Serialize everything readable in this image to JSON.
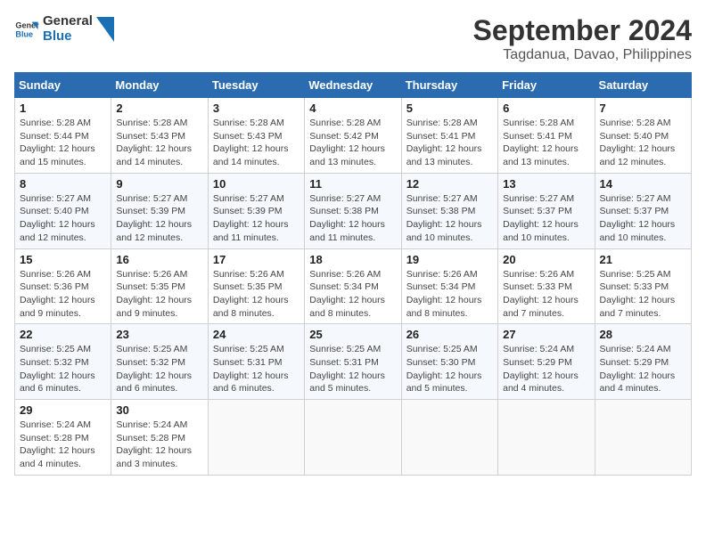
{
  "logo": {
    "text_general": "General",
    "text_blue": "Blue"
  },
  "title": "September 2024",
  "subtitle": "Tagdanua, Davao, Philippines",
  "weekdays": [
    "Sunday",
    "Monday",
    "Tuesday",
    "Wednesday",
    "Thursday",
    "Friday",
    "Saturday"
  ],
  "weeks": [
    [
      {
        "day": "1",
        "info": "Sunrise: 5:28 AM\nSunset: 5:44 PM\nDaylight: 12 hours\nand 15 minutes."
      },
      {
        "day": "2",
        "info": "Sunrise: 5:28 AM\nSunset: 5:43 PM\nDaylight: 12 hours\nand 14 minutes."
      },
      {
        "day": "3",
        "info": "Sunrise: 5:28 AM\nSunset: 5:43 PM\nDaylight: 12 hours\nand 14 minutes."
      },
      {
        "day": "4",
        "info": "Sunrise: 5:28 AM\nSunset: 5:42 PM\nDaylight: 12 hours\nand 13 minutes."
      },
      {
        "day": "5",
        "info": "Sunrise: 5:28 AM\nSunset: 5:41 PM\nDaylight: 12 hours\nand 13 minutes."
      },
      {
        "day": "6",
        "info": "Sunrise: 5:28 AM\nSunset: 5:41 PM\nDaylight: 12 hours\nand 13 minutes."
      },
      {
        "day": "7",
        "info": "Sunrise: 5:28 AM\nSunset: 5:40 PM\nDaylight: 12 hours\nand 12 minutes."
      }
    ],
    [
      {
        "day": "8",
        "info": "Sunrise: 5:27 AM\nSunset: 5:40 PM\nDaylight: 12 hours\nand 12 minutes."
      },
      {
        "day": "9",
        "info": "Sunrise: 5:27 AM\nSunset: 5:39 PM\nDaylight: 12 hours\nand 12 minutes."
      },
      {
        "day": "10",
        "info": "Sunrise: 5:27 AM\nSunset: 5:39 PM\nDaylight: 12 hours\nand 11 minutes."
      },
      {
        "day": "11",
        "info": "Sunrise: 5:27 AM\nSunset: 5:38 PM\nDaylight: 12 hours\nand 11 minutes."
      },
      {
        "day": "12",
        "info": "Sunrise: 5:27 AM\nSunset: 5:38 PM\nDaylight: 12 hours\nand 10 minutes."
      },
      {
        "day": "13",
        "info": "Sunrise: 5:27 AM\nSunset: 5:37 PM\nDaylight: 12 hours\nand 10 minutes."
      },
      {
        "day": "14",
        "info": "Sunrise: 5:27 AM\nSunset: 5:37 PM\nDaylight: 12 hours\nand 10 minutes."
      }
    ],
    [
      {
        "day": "15",
        "info": "Sunrise: 5:26 AM\nSunset: 5:36 PM\nDaylight: 12 hours\nand 9 minutes."
      },
      {
        "day": "16",
        "info": "Sunrise: 5:26 AM\nSunset: 5:35 PM\nDaylight: 12 hours\nand 9 minutes."
      },
      {
        "day": "17",
        "info": "Sunrise: 5:26 AM\nSunset: 5:35 PM\nDaylight: 12 hours\nand 8 minutes."
      },
      {
        "day": "18",
        "info": "Sunrise: 5:26 AM\nSunset: 5:34 PM\nDaylight: 12 hours\nand 8 minutes."
      },
      {
        "day": "19",
        "info": "Sunrise: 5:26 AM\nSunset: 5:34 PM\nDaylight: 12 hours\nand 8 minutes."
      },
      {
        "day": "20",
        "info": "Sunrise: 5:26 AM\nSunset: 5:33 PM\nDaylight: 12 hours\nand 7 minutes."
      },
      {
        "day": "21",
        "info": "Sunrise: 5:25 AM\nSunset: 5:33 PM\nDaylight: 12 hours\nand 7 minutes."
      }
    ],
    [
      {
        "day": "22",
        "info": "Sunrise: 5:25 AM\nSunset: 5:32 PM\nDaylight: 12 hours\nand 6 minutes."
      },
      {
        "day": "23",
        "info": "Sunrise: 5:25 AM\nSunset: 5:32 PM\nDaylight: 12 hours\nand 6 minutes."
      },
      {
        "day": "24",
        "info": "Sunrise: 5:25 AM\nSunset: 5:31 PM\nDaylight: 12 hours\nand 6 minutes."
      },
      {
        "day": "25",
        "info": "Sunrise: 5:25 AM\nSunset: 5:31 PM\nDaylight: 12 hours\nand 5 minutes."
      },
      {
        "day": "26",
        "info": "Sunrise: 5:25 AM\nSunset: 5:30 PM\nDaylight: 12 hours\nand 5 minutes."
      },
      {
        "day": "27",
        "info": "Sunrise: 5:24 AM\nSunset: 5:29 PM\nDaylight: 12 hours\nand 4 minutes."
      },
      {
        "day": "28",
        "info": "Sunrise: 5:24 AM\nSunset: 5:29 PM\nDaylight: 12 hours\nand 4 minutes."
      }
    ],
    [
      {
        "day": "29",
        "info": "Sunrise: 5:24 AM\nSunset: 5:28 PM\nDaylight: 12 hours\nand 4 minutes."
      },
      {
        "day": "30",
        "info": "Sunrise: 5:24 AM\nSunset: 5:28 PM\nDaylight: 12 hours\nand 3 minutes."
      },
      {
        "day": "",
        "info": ""
      },
      {
        "day": "",
        "info": ""
      },
      {
        "day": "",
        "info": ""
      },
      {
        "day": "",
        "info": ""
      },
      {
        "day": "",
        "info": ""
      }
    ]
  ]
}
